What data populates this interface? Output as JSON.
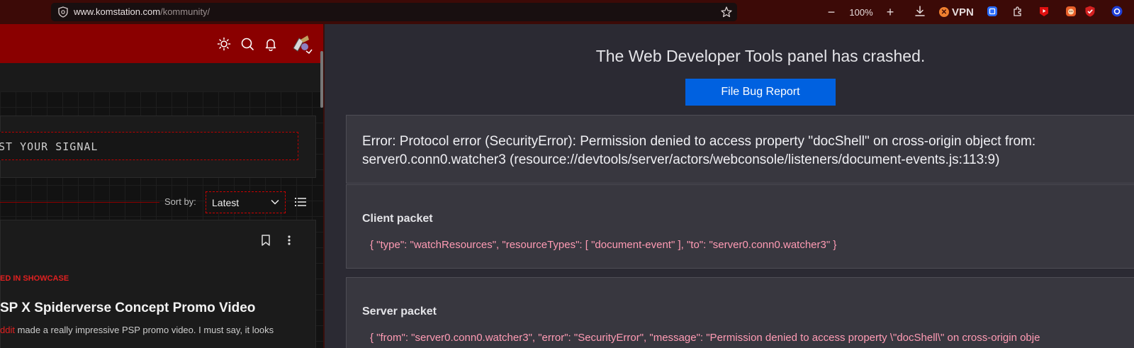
{
  "browser": {
    "url_domain": "www.komstation.com",
    "url_path": "/kommunity/",
    "zoom": "100%",
    "zoom_out": "−",
    "zoom_in": "+",
    "vpn_label": "VPN",
    "vpn_mark": "✕"
  },
  "page": {
    "signal_placeholder": "ST YOUR SIGNAL",
    "sort_label": "Sort by:",
    "sort_value": "Latest",
    "post": {
      "featured": "ED IN SHOWCASE",
      "title": "SP X Spiderverse Concept Promo Video",
      "author_fragment": "ddit",
      "body": " made a really impressive PSP promo video. I must say, it looks"
    }
  },
  "devtools": {
    "crash_title": "The Web Developer Tools panel has crashed.",
    "file_bug_label": "File Bug Report",
    "error_text": "Error: Protocol error (SecurityError): Permission denied to access property \"docShell\" on cross-origin object from: server0.conn0.watcher3 (resource://devtools/server/actors/webconsole/listeners/document-events.js:113:9)",
    "client_packet_label": "Client packet",
    "client_packet": "{ \"type\": \"watchResources\", \"resourceTypes\": [ \"document-event\" ], \"to\": \"server0.conn0.watcher3\" }",
    "server_packet_label": "Server packet",
    "server_packet": "{ \"from\": \"server0.conn0.watcher3\", \"error\": \"SecurityError\", \"message\": \"Permission denied to access property \\\"docShell\\\" on cross-origin obje"
  },
  "colors": {
    "toolbar": "#3c0a07",
    "site_header": "#8a0000",
    "accent_red": "#e02020",
    "button_blue": "#0061e0",
    "panel_bg": "#2b2a33",
    "packet_text": "#ff9bb4"
  }
}
